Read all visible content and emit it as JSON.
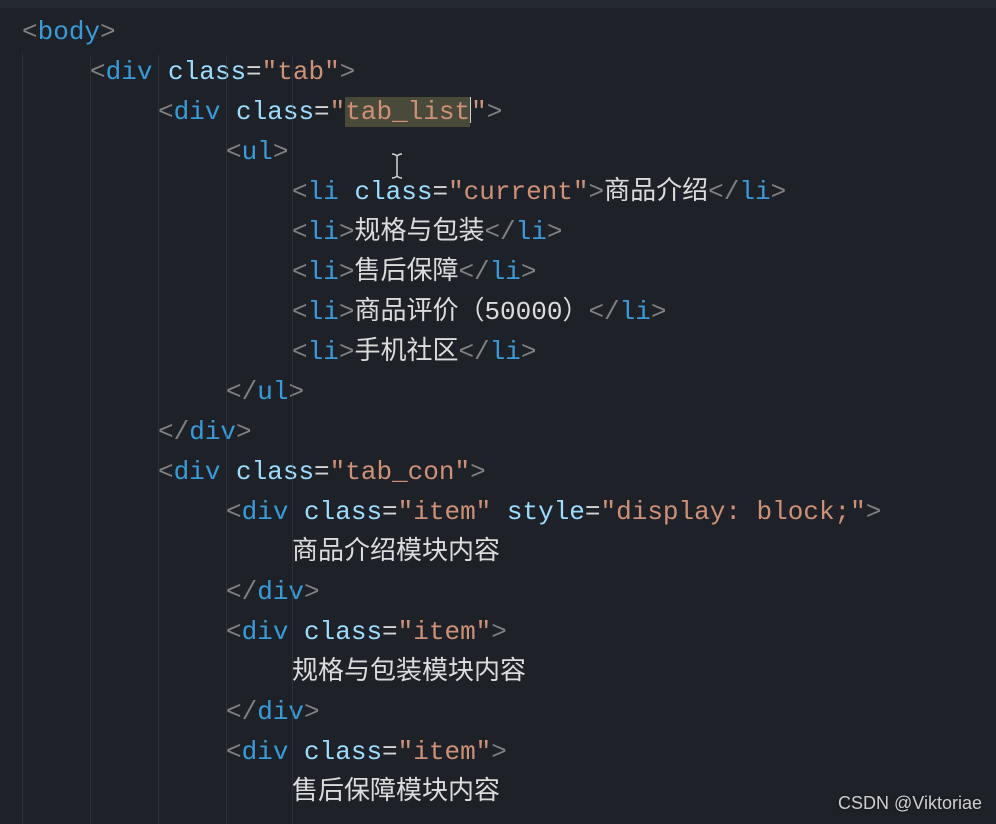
{
  "code": {
    "lines": [
      {
        "indent": 0,
        "type": "open",
        "tag": "body",
        "attrs": []
      },
      {
        "indent": 1,
        "type": "open",
        "tag": "div",
        "attrs": [
          {
            "name": "class",
            "value": "tab"
          }
        ]
      },
      {
        "indent": 2,
        "type": "open",
        "tag": "div",
        "attrs": [
          {
            "name": "class",
            "value": "tab_list",
            "hasSel": true,
            "hasCursor": true
          }
        ]
      },
      {
        "indent": 3,
        "type": "open",
        "tag": "ul",
        "attrs": []
      },
      {
        "indent": 4,
        "type": "full",
        "tag": "li",
        "attrs": [
          {
            "name": "class",
            "value": "current"
          }
        ],
        "text": "商品介绍"
      },
      {
        "indent": 4,
        "type": "full",
        "tag": "li",
        "attrs": [],
        "text": "规格与包装"
      },
      {
        "indent": 4,
        "type": "full",
        "tag": "li",
        "attrs": [],
        "text": "售后保障"
      },
      {
        "indent": 4,
        "type": "full",
        "tag": "li",
        "attrs": [],
        "text": "商品评价（50000）"
      },
      {
        "indent": 4,
        "type": "full",
        "tag": "li",
        "attrs": [],
        "text": "手机社区"
      },
      {
        "indent": 3,
        "type": "close",
        "tag": "ul"
      },
      {
        "indent": 2,
        "type": "close",
        "tag": "div"
      },
      {
        "indent": 2,
        "type": "open",
        "tag": "div",
        "attrs": [
          {
            "name": "class",
            "value": "tab_con"
          }
        ]
      },
      {
        "indent": 3,
        "type": "open",
        "tag": "div",
        "attrs": [
          {
            "name": "class",
            "value": "item"
          },
          {
            "name": "style",
            "value": "display: block;"
          }
        ]
      },
      {
        "indent": 4,
        "type": "text",
        "text": "商品介绍模块内容"
      },
      {
        "indent": 3,
        "type": "close",
        "tag": "div"
      },
      {
        "indent": 3,
        "type": "open",
        "tag": "div",
        "attrs": [
          {
            "name": "class",
            "value": "item"
          }
        ]
      },
      {
        "indent": 4,
        "type": "text",
        "text": "规格与包装模块内容"
      },
      {
        "indent": 3,
        "type": "close",
        "tag": "div"
      },
      {
        "indent": 3,
        "type": "open",
        "tag": "div",
        "attrs": [
          {
            "name": "class",
            "value": "item"
          }
        ]
      },
      {
        "indent": 4,
        "type": "text",
        "text": "售后保障模块内容"
      }
    ]
  },
  "watermark": "CSDN @Viktoriae"
}
